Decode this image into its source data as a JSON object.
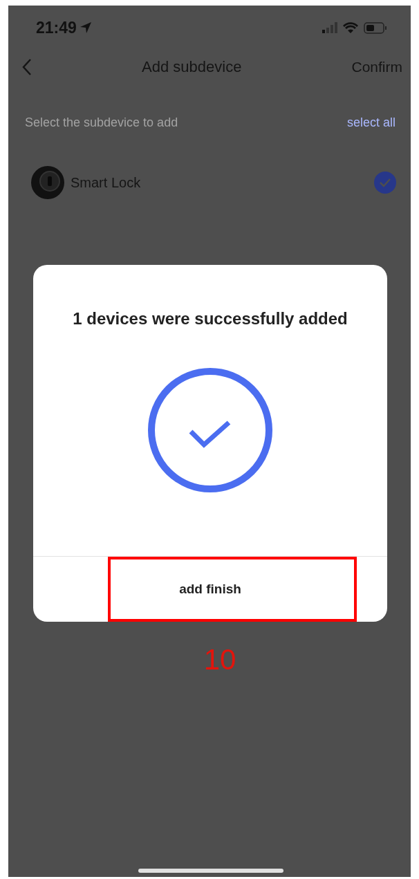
{
  "status_bar": {
    "time": "21:49"
  },
  "nav": {
    "title": "Add subdevice",
    "action": "Confirm"
  },
  "section": {
    "hint": "Select the subdevice to add",
    "select_all": "select all"
  },
  "devices": [
    {
      "name": "Smart Lock",
      "selected": true
    }
  ],
  "dialog": {
    "title": "1 devices were successfully added",
    "button": "add finish"
  },
  "annotation": {
    "label": "10"
  }
}
